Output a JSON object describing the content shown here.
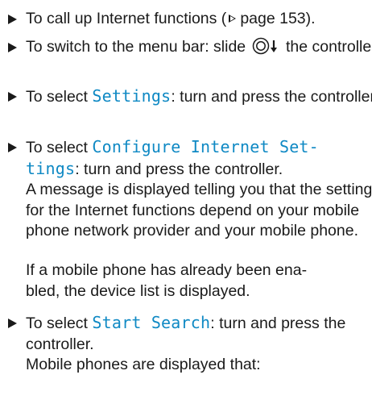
{
  "steps": [
    {
      "before": "To call up Internet functions (",
      "page_ref": "page 153",
      "after": ")."
    },
    {
      "before": "To switch to the menu bar: slide",
      "after": "the controller."
    },
    {
      "before": "To select ",
      "ui": "Settings",
      "after": ": turn and press the controller."
    },
    {
      "before": "To select ",
      "ui_line1": "Configure Internet Set-",
      "ui_line2": "tings",
      "after": ": turn and press the controller.",
      "result": "A message is displayed telling you that the settings for the Internet functions depend on your mobile phone network provider and your mobile phone."
    },
    {
      "note_line1": "If a mobile phone has already been ena-",
      "note_line2": "bled, the device list is displayed."
    },
    {
      "before": "To select ",
      "ui": "Start Search",
      "after": ": turn and press the controller.",
      "result": "Mobile phones are displayed that:"
    }
  ]
}
